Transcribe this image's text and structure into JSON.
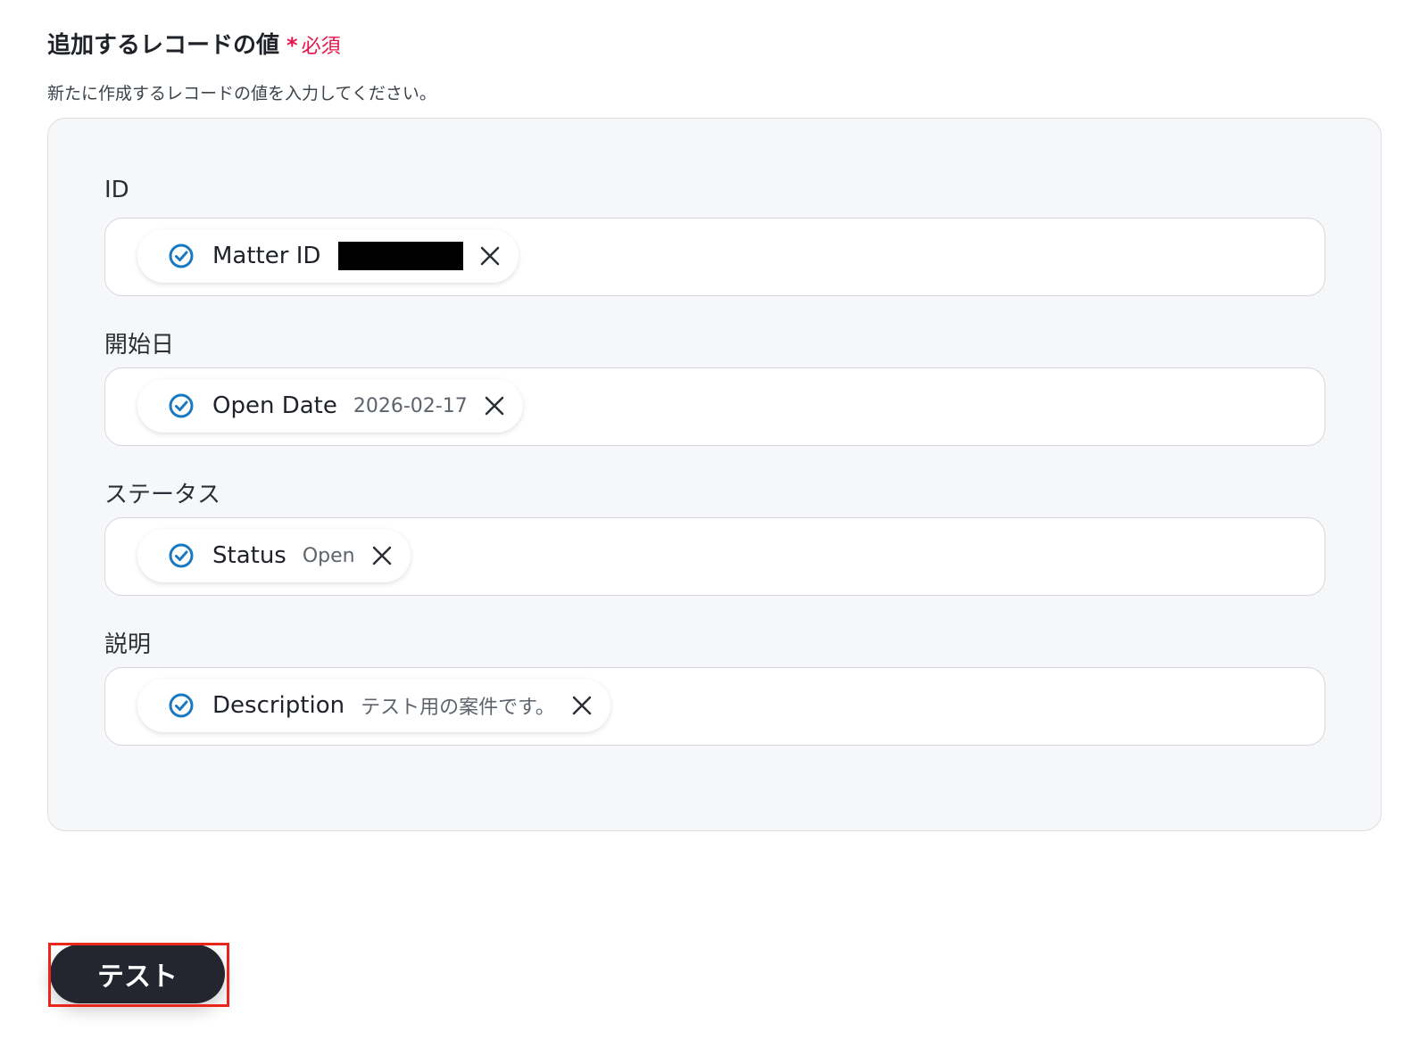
{
  "section": {
    "title": "追加するレコードの値",
    "required_mark": "*",
    "required_text": "必須",
    "description": "新たに作成するレコードの値を入力してください。"
  },
  "fields": [
    {
      "label": "ID",
      "chip_name": "Matter ID",
      "chip_value": "",
      "value_redacted": true,
      "icon": "check-circle-icon",
      "remove_icon": "close-icon"
    },
    {
      "label": "開始日",
      "chip_name": "Open Date",
      "chip_value": "2026-02-17",
      "value_redacted": false,
      "icon": "check-circle-icon",
      "remove_icon": "close-icon"
    },
    {
      "label": "ステータス",
      "chip_name": "Status",
      "chip_value": "Open",
      "value_redacted": false,
      "icon": "check-circle-icon",
      "remove_icon": "close-icon"
    },
    {
      "label": "説明",
      "chip_name": "Description",
      "chip_value": "テスト用の案件です。",
      "value_redacted": false,
      "icon": "check-circle-icon",
      "remove_icon": "close-icon"
    }
  ],
  "actions": {
    "test_label": "テスト"
  },
  "colors": {
    "accent": "#1a78c2",
    "required": "#e5154b",
    "button_bg": "#23262e",
    "highlight": "#e8261c"
  }
}
